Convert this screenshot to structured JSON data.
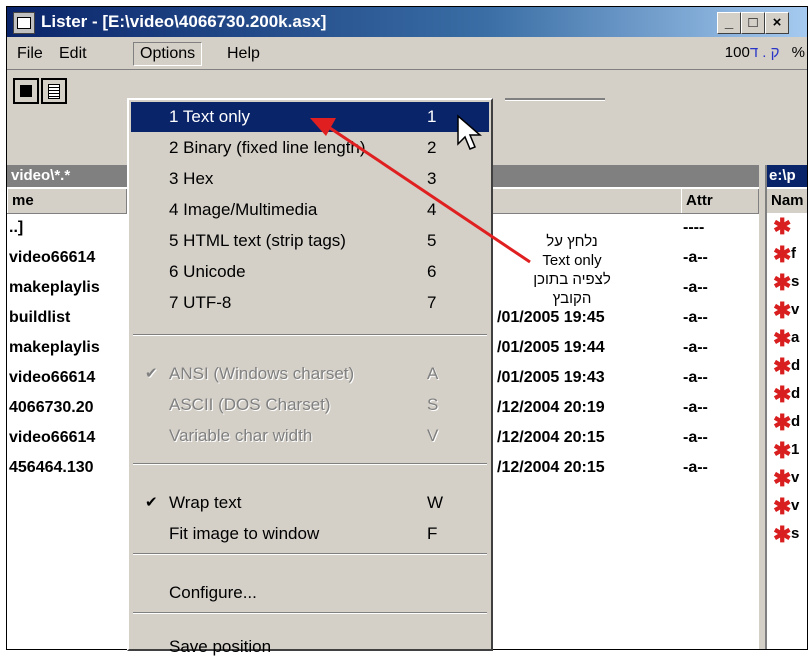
{
  "window": {
    "title": "Lister - [E:\\video\\4066730.200k.asx]",
    "buttons": [
      "_",
      "□",
      "×"
    ]
  },
  "menubar": {
    "items": [
      "File",
      "Edit",
      "Options",
      "Help"
    ],
    "right_hebrew": "ק . ד",
    "zoom": "100 %"
  },
  "left_panel": {
    "path": "video\\*.*",
    "columns": [
      "me",
      "Attr"
    ],
    "rows": [
      {
        "name": "..]",
        "date": "",
        "attr": "----"
      },
      {
        "name": "video66614",
        "date": "",
        "attr": "-a--"
      },
      {
        "name": "makeplaylis",
        "date": "",
        "attr": "-a--"
      },
      {
        "name": "buildlist",
        "date": "/01/2005 19:45",
        "attr": "-a--"
      },
      {
        "name": "makeplaylis",
        "date": "/01/2005 19:44",
        "attr": "-a--"
      },
      {
        "name": "video66614",
        "date": "/01/2005 19:43",
        "attr": "-a--"
      },
      {
        "name": "4066730.20",
        "date": "/12/2004 20:19",
        "attr": "-a--"
      },
      {
        "name": "video66614",
        "date": "/12/2004 20:15",
        "attr": "-a--"
      },
      {
        "name": "456464.130",
        "date": "/12/2004 20:15",
        "attr": "-a--"
      }
    ]
  },
  "right_panel": {
    "path": "e:\\p",
    "column": "Nam",
    "row_letters": [
      "",
      "f",
      "s",
      "v",
      "a",
      "d",
      "d",
      "d",
      "1",
      "v",
      "v",
      "s"
    ]
  },
  "options_menu": {
    "items": [
      {
        "label": "1 Text only",
        "accel": "1",
        "state": "selected"
      },
      {
        "label": "2 Binary (fixed line length)",
        "accel": "2",
        "state": "normal"
      },
      {
        "label": "3 Hex",
        "accel": "3",
        "state": "normal"
      },
      {
        "label": "4 Image/Multimedia",
        "accel": "4",
        "state": "normal"
      },
      {
        "label": "5 HTML text (strip tags)",
        "accel": "5",
        "state": "normal"
      },
      {
        "label": "6 Unicode",
        "accel": "6",
        "state": "normal"
      },
      {
        "label": "7 UTF-8",
        "accel": "7",
        "state": "normal"
      },
      {
        "label": "ANSI (Windows charset)",
        "accel": "A",
        "state": "disabled-checked"
      },
      {
        "label": "ASCII (DOS Charset)",
        "accel": "S",
        "state": "disabled"
      },
      {
        "label": "Variable char width",
        "accel": "V",
        "state": "disabled"
      },
      {
        "label": "Wrap text",
        "accel": "W",
        "state": "checked"
      },
      {
        "label": "Fit image to window",
        "accel": "F",
        "state": "normal"
      },
      {
        "label": "Configure...",
        "accel": "",
        "state": "normal"
      },
      {
        "label": "Save position",
        "accel": "",
        "state": "normal"
      }
    ]
  },
  "annotation": {
    "line1": "נלחץ על",
    "line2": "Text only",
    "line3": "לצפיה בתוכן",
    "line4": "הקובץ",
    "color": "#e02020"
  }
}
